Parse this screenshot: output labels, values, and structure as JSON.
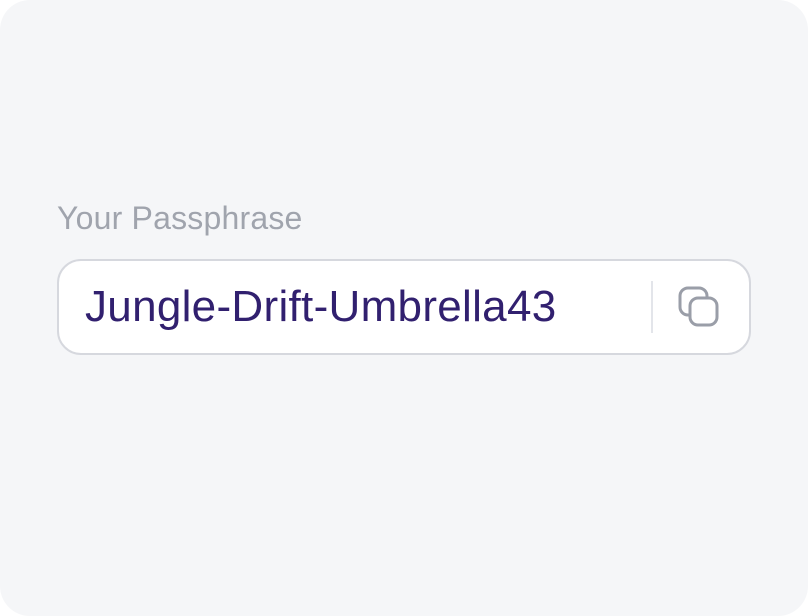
{
  "passphrase": {
    "label": "Your Passphrase",
    "value": "Jungle-Drift-Umbrella43",
    "copy_icon": "copy-icon"
  },
  "colors": {
    "card_background": "#f5f6f8",
    "label": "#a0a4ad",
    "value_text": "#31206f",
    "field_border": "#d6d8de",
    "icon": "#9a9ea8"
  }
}
